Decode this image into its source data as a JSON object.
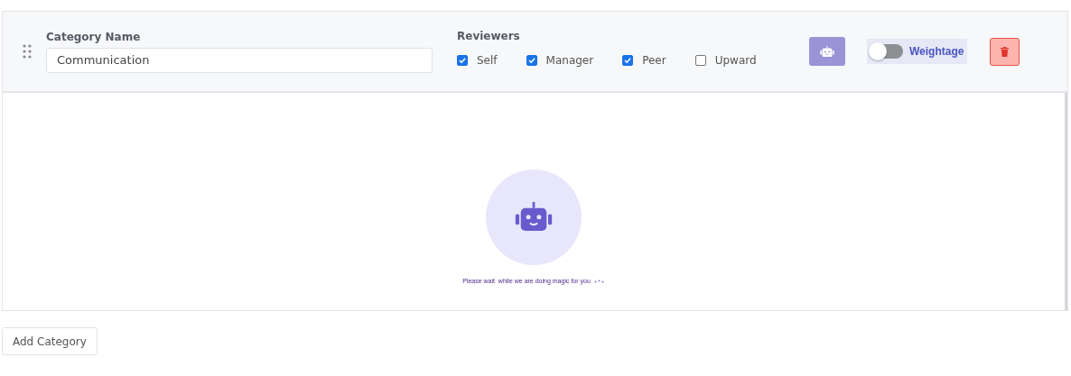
{
  "category": {
    "label": "Category Name",
    "value": "Communication"
  },
  "reviewers": {
    "label": "Reviewers",
    "options": [
      {
        "label": "Self",
        "checked": true
      },
      {
        "label": "Manager",
        "checked": true
      },
      {
        "label": "Peer",
        "checked": true
      },
      {
        "label": "Upward",
        "checked": false
      }
    ]
  },
  "weightage": {
    "label": "Weightage",
    "on": false
  },
  "loading": {
    "message": "Please wait  while we are doing magic for you"
  },
  "add_button": "Add Category"
}
